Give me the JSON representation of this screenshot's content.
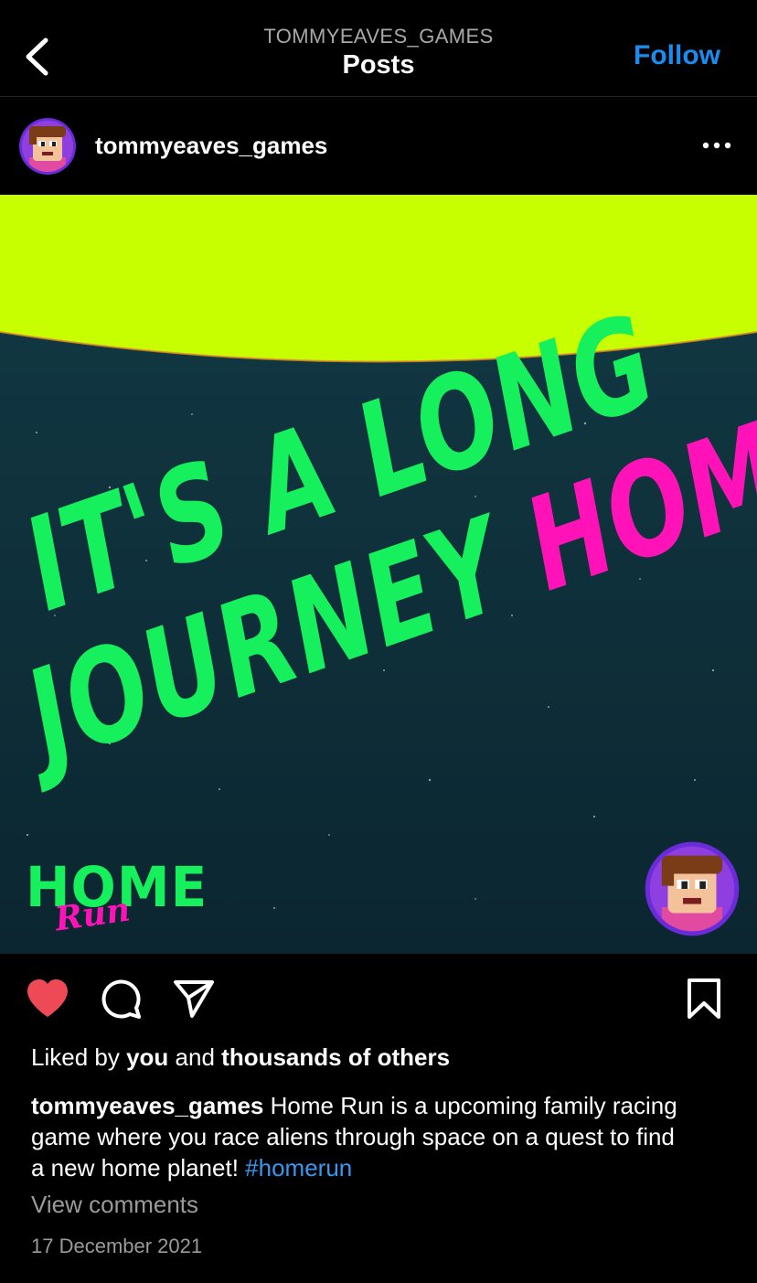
{
  "topbar": {
    "account": "TOMMYEAVES_GAMES",
    "title": "Posts",
    "follow_label": "Follow",
    "back_icon": "chevron-left-icon"
  },
  "post": {
    "username": "tommyeaves_games",
    "more_icon": "ellipsis-icon",
    "image": {
      "headline_line1": "IT'S A LONG",
      "headline_line2a": "JOURNEY",
      "headline_line2b": "HOME...",
      "logo_home": "HOME",
      "logo_run": "Run",
      "colors": {
        "planet": "#c8ff00",
        "space": "#0f2f3a",
        "green": "#16f05c",
        "pink": "#ff13b9"
      }
    },
    "actions": {
      "like_icon": "heart-icon",
      "comment_icon": "comment-icon",
      "share_icon": "send-icon",
      "save_icon": "bookmark-icon",
      "liked": true,
      "like_color": "#ed4956"
    },
    "likes": {
      "prefix": "Liked by",
      "you": "you",
      "and": "and",
      "others": "thousands of others"
    },
    "caption": {
      "username": "tommyeaves_games",
      "text": "Home Run is a upcoming family racing game where you race aliens through space on a quest to find a new home planet!",
      "hashtag": "#homerun"
    },
    "view_comments": "View comments",
    "date": "17 December 2021"
  }
}
